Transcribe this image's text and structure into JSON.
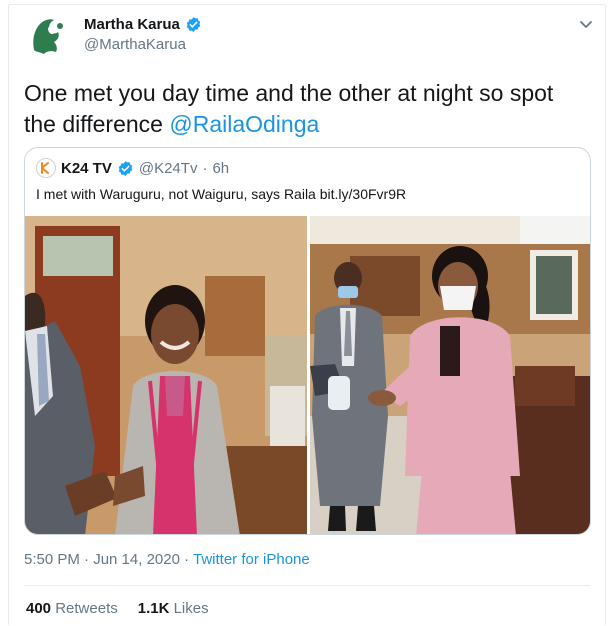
{
  "tweet": {
    "author_name": "Martha Karua",
    "author_handle": "@MarthaKarua",
    "text_before": "One met you day time and the other at night so spot the difference ",
    "mention": "@RailaOdinga",
    "timestamp": "5:50 PM · Jun 14, 2020 · ",
    "source": "Twitter for iPhone",
    "retweets_count": "400",
    "retweets_label": "Retweets",
    "likes_count": "1.1K",
    "likes_label": "Likes"
  },
  "quoted": {
    "name": "K24 TV",
    "handle": "@K24Tv",
    "separator": "·",
    "time": "6h",
    "text": "I met with Waruguru, not Waiguru, says Raila bit.ly/30Fvr9R"
  },
  "icons": {
    "verified": "verified-badge-icon",
    "menu": "chevron-down-icon",
    "logo": "k24-logo-icon"
  },
  "colors": {
    "link": "#1b95e0",
    "verified": "#1da1f2",
    "secondary_text": "#657786"
  }
}
